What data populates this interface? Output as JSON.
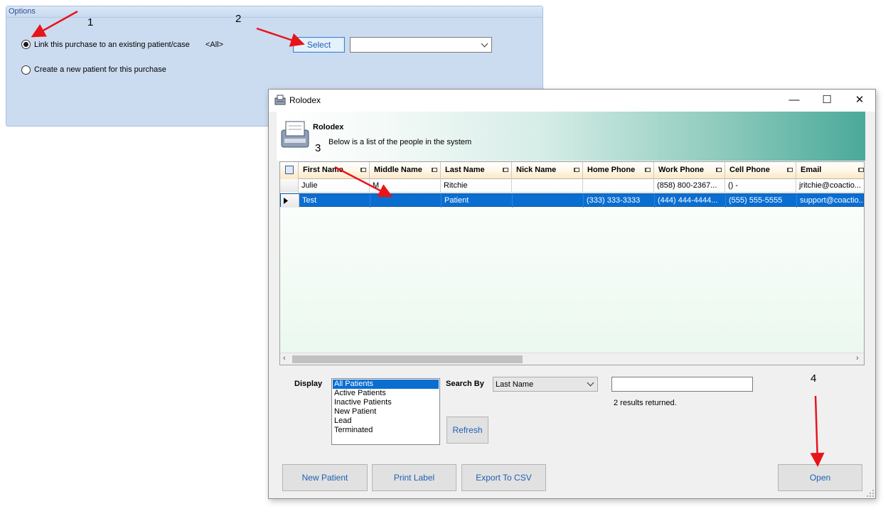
{
  "options": {
    "header": "Options",
    "link_existing_label": "Link this purchase to an existing patient/case",
    "link_existing_checked": true,
    "filter_text": "<All>",
    "select_button": "Select",
    "case_combo_value": "",
    "create_new_label": "Create a new patient for this purchase",
    "create_new_checked": false
  },
  "rolodex": {
    "window_title": "Rolodex",
    "banner_title": "Rolodex",
    "banner_subtitle": "Below is a list of the people in the system",
    "columns": [
      "First Name",
      "Middle Name",
      "Last Name",
      "Nick Name",
      "Home Phone",
      "Work Phone",
      "Cell Phone",
      "Email"
    ],
    "rows": [
      {
        "first": "Julie",
        "middle": "M",
        "last": "Ritchie",
        "nick": "",
        "home": "",
        "work": "(858)  800-2367...",
        "cell": "() -",
        "email": "jritchie@coactio...",
        "selected": false
      },
      {
        "first": "Test",
        "middle": "",
        "last": "Patient",
        "nick": "",
        "home": "(333) 333-3333",
        "work": "(444)  444-4444...",
        "cell": "(555) 555-5555",
        "email": "support@coactio...",
        "selected": true
      }
    ],
    "display_label": "Display",
    "display_options": [
      "All Patients",
      "Active Patients",
      "Inactive Patients",
      "New Patient",
      "Lead",
      "Terminated"
    ],
    "display_selected": "All Patients",
    "search_by_label": "Search By",
    "search_by_value": "Last Name",
    "search_text": "",
    "results_text": "2 results returned.",
    "refresh_button": "Refresh",
    "new_patient_button": "New Patient",
    "print_label_button": "Print Label",
    "export_csv_button": "Export To CSV",
    "open_button": "Open"
  },
  "annotations": {
    "step1": "1",
    "step2": "2",
    "step3": "3",
    "step4": "4",
    "arrow_color": "#e8141b"
  }
}
